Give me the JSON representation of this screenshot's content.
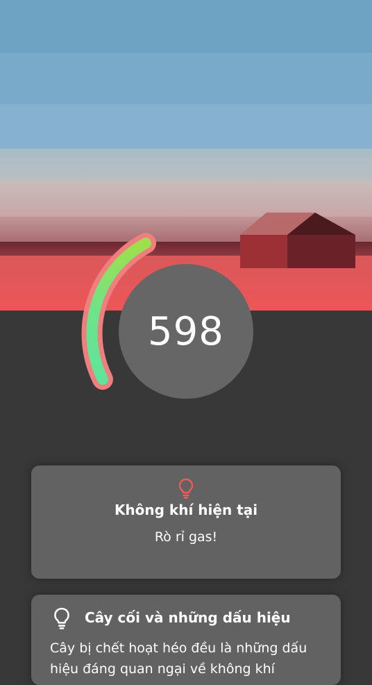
{
  "score": {
    "value": "598",
    "level_fraction": 0.55
  },
  "current_air": {
    "icon": "lightbulb-icon",
    "title": "Không khí hiện tại",
    "status": "Rò rỉ gas!"
  },
  "tips": {
    "icon": "lightbulb-icon",
    "title": "Cây cối và những dấu hiệu",
    "body": "Cây bị chết hoạt héo đều là những dấu hiệu đáng quan ngại về không khí"
  },
  "colors": {
    "sky": "#7aaac9",
    "alert_red": "#ee5656",
    "gauge_green": "#6ee38a",
    "gauge_outline": "#ef7f7f",
    "background": "#383838",
    "card": "#626262",
    "icon_red": "#f05a5a"
  }
}
